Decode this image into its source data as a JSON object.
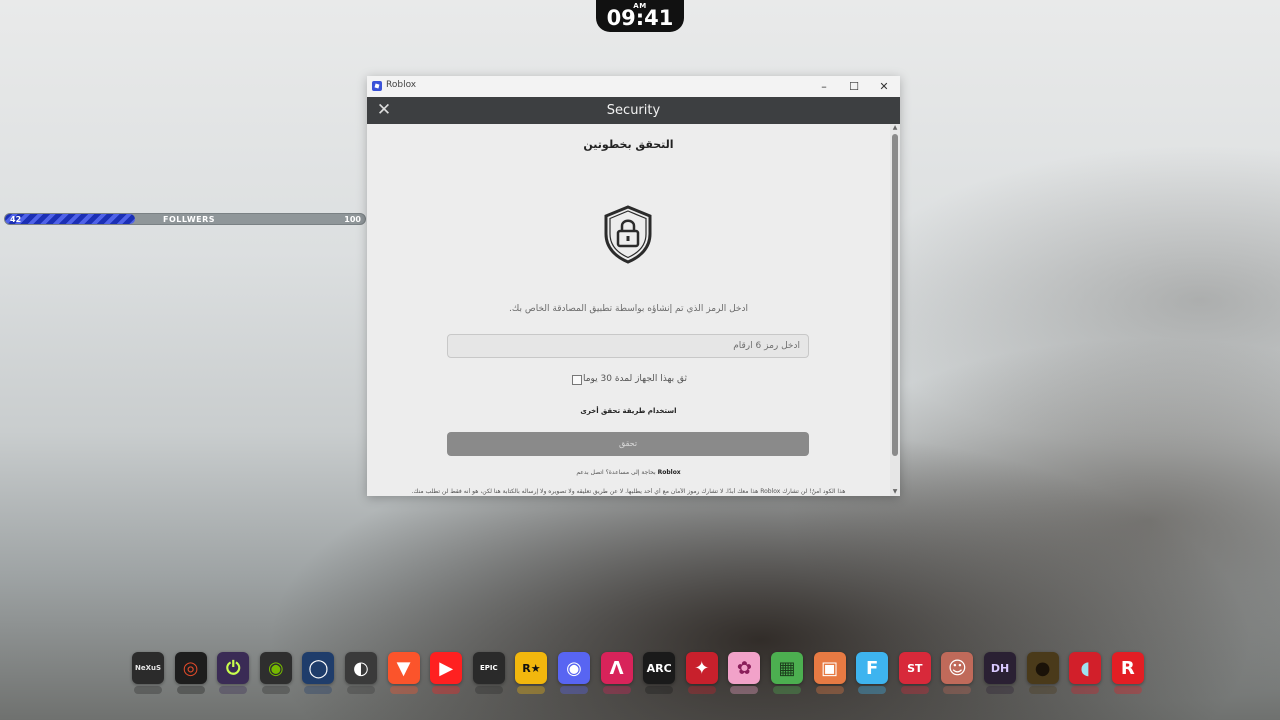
{
  "clock": {
    "ampm": "AM",
    "time": "09:41"
  },
  "follower_bar": {
    "current": "42",
    "label": "FOLLWERS",
    "goal": "100",
    "progress_fraction": 0.42
  },
  "window": {
    "app_title": "Roblox",
    "controls": {
      "minimize": "–",
      "maximize": "☐",
      "close": "✕"
    },
    "header_title": "Security",
    "close_glyph": "✕"
  },
  "form": {
    "heading": "التحقق بخطوتين",
    "instruction": "ادخل الرمز الذي تم إنشاؤه بواسطة تطبيق المصادقة الخاص بك.",
    "code_placeholder": "ادخل رمز 6 ارقام",
    "trust_device_label": "ثق بهذا الجهاز لمدة 30 يوما",
    "alt_method_link": "استخدام طريقة تحقق أخرى",
    "verify_button": "تحقق",
    "help_text_prefix": "بحاجة إلى مساعدة؟ اتصل بدعم",
    "help_text_brand": "Roblox",
    "warning_text": "هذا الكود أمنٌ! لن تشارك Roblox هذا معك أبدًا. لا تشارك رموز الأمان مع أي أحد يطلبها. لا عن طريق تعليقه ولا تصويره ولا إرساله بالكتابة هنا لكن، هو أنه فقط لن تطلب منك."
  },
  "dock": {
    "items": [
      {
        "name": "nexus-icon",
        "text": "NeXuS",
        "bg": "#2b2b2b",
        "fg": "#e8e8e8"
      },
      {
        "name": "crosshair-app-icon",
        "text": "◎",
        "bg": "#1d1d1d",
        "fg": "#e04a2a"
      },
      {
        "name": "power-app-icon",
        "text": "⏻",
        "bg": "#3a2b55",
        "fg": "#c9ff4d"
      },
      {
        "name": "nvidia-icon",
        "text": "◉",
        "bg": "#2e2e2e",
        "fg": "#76b900"
      },
      {
        "name": "camera-app-icon",
        "text": "◯",
        "bg": "#1f3d6b",
        "fg": "#ffffff"
      },
      {
        "name": "obs-icon",
        "text": "◐",
        "bg": "#3a3a3a",
        "fg": "#ffffff"
      },
      {
        "name": "brave-icon",
        "text": "▼",
        "bg": "#fb542b",
        "fg": "#ffffff"
      },
      {
        "name": "youtube-icon",
        "text": "▶",
        "bg": "#ff2020",
        "fg": "#ffffff"
      },
      {
        "name": "epic-games-icon",
        "text": "EPIC",
        "bg": "#2a2a2a",
        "fg": "#ffffff"
      },
      {
        "name": "rockstar-icon",
        "text": "R★",
        "bg": "#f2b70d",
        "fg": "#111111"
      },
      {
        "name": "discord-icon",
        "text": "◉",
        "bg": "#5865f2",
        "fg": "#ffffff"
      },
      {
        "name": "apex-icon",
        "text": "Λ",
        "bg": "#d8235a",
        "fg": "#ffffff"
      },
      {
        "name": "arc-raiders-icon",
        "text": "ARC",
        "bg": "#1a1a1a",
        "fg": "#ffffff"
      },
      {
        "name": "bird-app-icon",
        "text": "✦",
        "bg": "#c8202c",
        "fg": "#ffffff"
      },
      {
        "name": "candy-game-icon",
        "text": "✿",
        "bg": "#f2a2c9",
        "fg": "#8a1e5a"
      },
      {
        "name": "minecraft-icon",
        "text": "▦",
        "bg": "#4caf50",
        "fg": "#1b3d1b"
      },
      {
        "name": "tv-app-icon",
        "text": "▣",
        "bg": "#e77a43",
        "fg": "#ffffff"
      },
      {
        "name": "fortnite-icon",
        "text": "F",
        "bg": "#3eb4ef",
        "fg": "#ffffff"
      },
      {
        "name": "st-app-icon",
        "text": "ST",
        "bg": "#d8293a",
        "fg": "#ffffff"
      },
      {
        "name": "game-character-icon",
        "text": "☺",
        "bg": "#c06a5a",
        "fg": "#ffffff"
      },
      {
        "name": "dark-hours-icon",
        "text": "DH",
        "bg": "#2a2033",
        "fg": "#d9c9ff"
      },
      {
        "name": "mask-game-icon",
        "text": "●",
        "bg": "#4a3a1a",
        "fg": "#1a1208"
      },
      {
        "name": "among-us-icon",
        "text": "◖",
        "bg": "#d21f2a",
        "fg": "#9fe1f0"
      },
      {
        "name": "roblox-r-icon",
        "text": "R",
        "bg": "#e31e24",
        "fg": "#ffffff"
      }
    ]
  }
}
